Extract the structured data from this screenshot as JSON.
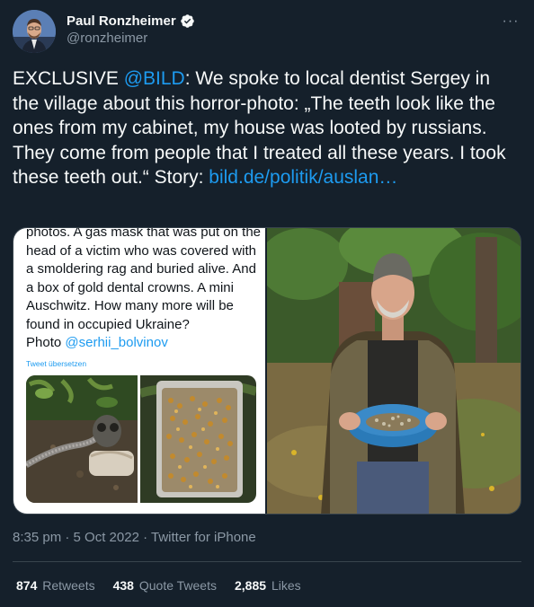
{
  "author": {
    "name": "Paul Ronzheimer",
    "handle": "@ronzheimer"
  },
  "more_label": "···",
  "tweet": {
    "prefix": "EXCLUSIVE ",
    "mention": "@BILD",
    "body": ": We spoke to local dentist Sergey in the village about this horror-photo: „The teeth look like the ones from my cabinet, my house was looted by russians. They come from people that I treated all these years. I took these teeth out.“ Story: ",
    "link": "bild.de/politik/auslan…"
  },
  "embedded": {
    "text": "photos. A gas mask that was put on the head of a victim who was covered with a smoldering rag and buried alive. And a box of gold dental crowns. A mini Auschwitz. How many more will be found in occupied Ukraine?",
    "photo_prefix": "Photo ",
    "photo_mention": "@serhii_bolvinov",
    "translate": "Tweet übersetzen"
  },
  "meta": {
    "time": "8:35 pm",
    "sep1": " · ",
    "date": "5 Oct 2022",
    "sep2": " · ",
    "source": "Twitter for iPhone"
  },
  "stats": {
    "retweets_count": "874",
    "retweets_label": "Retweets",
    "quotes_count": "438",
    "quotes_label": "Quote Tweets",
    "likes_count": "2,885",
    "likes_label": "Likes"
  },
  "colors": {
    "background": "#15202b",
    "link": "#1d9bf0",
    "secondary_text": "#8b98a5",
    "border": "#38444d"
  }
}
